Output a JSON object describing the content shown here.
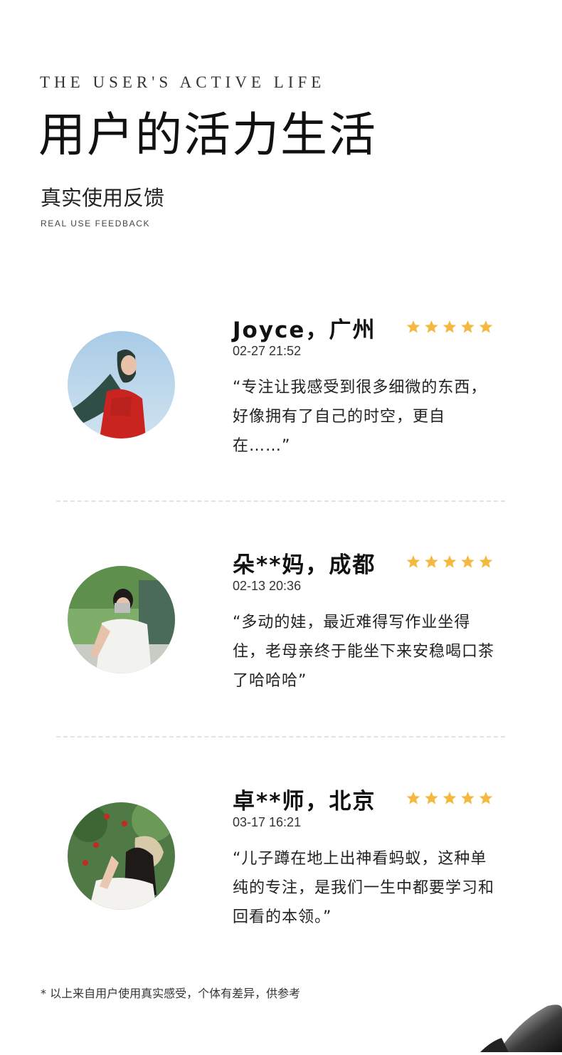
{
  "header": {
    "eyebrow": "THE USER'S ACTIVE LIFE",
    "title": "用户的活力生活",
    "subtitle": "真实使用反馈",
    "subtitle_en": "REAL USE FEEDBACK"
  },
  "rating_color": "#f5b942",
  "reviews": [
    {
      "name": "Joyce，广州",
      "time": "02-27 21:52",
      "rating": 5,
      "quote": "“专注让我感受到很多细微的东西，好像拥有了自己的时空，更自在……”"
    },
    {
      "name": "朵**妈，成都",
      "time": "02-13 20:36",
      "rating": 5,
      "quote": "“多动的娃，最近难得写作业坐得住，老母亲终于能坐下来安稳喝口茶了哈哈哈”"
    },
    {
      "name": "卓**师，北京",
      "time": "03-17 16:21",
      "rating": 5,
      "quote": "“儿子蹲在地上出神看蚂蚁，这种单纯的专注，是我们一生中都要学习和回看的本领。”"
    }
  ],
  "footnote": "* 以上来自用户使用真实感受，个体有差异，供参考"
}
